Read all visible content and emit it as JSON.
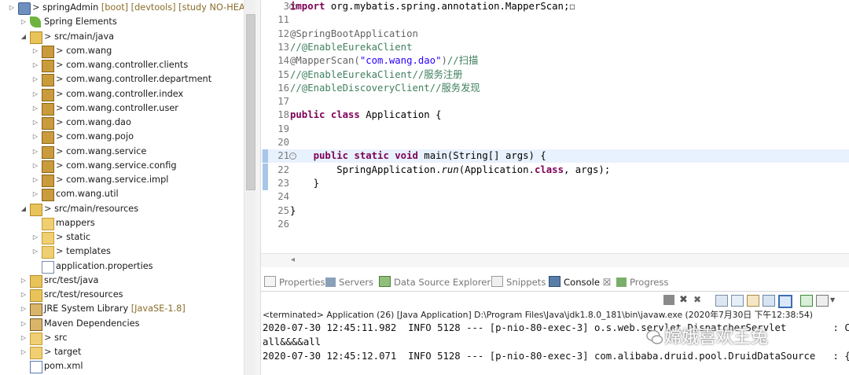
{
  "tree": {
    "rows": [
      {
        "tw": "▷",
        "label": "springAdmin",
        "deco": "[boot] [devtools] [study NO-HEAD]",
        "prefix": ">",
        "icon": "project-icon"
      },
      {
        "tw": "▷",
        "label": "Spring Elements",
        "icon": "spring-leaf-icon"
      },
      {
        "tw": "◢",
        "label": "src/main/java",
        "prefix": ">",
        "icon": "source-folder-icon"
      },
      {
        "tw": "▷",
        "label": "com.wang",
        "prefix": ">",
        "icon": "package-icon"
      },
      {
        "tw": "▷",
        "label": "com.wang.controller.clients",
        "prefix": ">",
        "icon": "package-icon"
      },
      {
        "tw": "▷",
        "label": "com.wang.controller.department",
        "prefix": ">",
        "icon": "package-icon"
      },
      {
        "tw": "▷",
        "label": "com.wang.controller.index",
        "prefix": ">",
        "icon": "package-icon"
      },
      {
        "tw": "▷",
        "label": "com.wang.controller.user",
        "prefix": ">",
        "icon": "package-icon"
      },
      {
        "tw": "▷",
        "label": "com.wang.dao",
        "prefix": ">",
        "icon": "package-icon"
      },
      {
        "tw": "▷",
        "label": "com.wang.pojo",
        "prefix": ">",
        "icon": "package-icon"
      },
      {
        "tw": "▷",
        "label": "com.wang.service",
        "prefix": ">",
        "icon": "package-icon"
      },
      {
        "tw": "▷",
        "label": "com.wang.service.config",
        "prefix": ">",
        "icon": "package-icon"
      },
      {
        "tw": "▷",
        "label": "com.wang.service.impl",
        "prefix": ">",
        "icon": "package-icon"
      },
      {
        "tw": "▷",
        "label": "com.wang.util",
        "icon": "package-icon"
      },
      {
        "tw": "◢",
        "label": "src/main/resources",
        "prefix": ">",
        "icon": "source-folder-icon"
      },
      {
        "tw": "",
        "label": "mappers",
        "icon": "folder-icon"
      },
      {
        "tw": "▷",
        "label": "static",
        "prefix": ">",
        "icon": "folder-icon"
      },
      {
        "tw": "▷",
        "label": "templates",
        "prefix": ">",
        "icon": "folder-icon"
      },
      {
        "tw": "",
        "label": "application.properties",
        "icon": "properties-file-icon"
      },
      {
        "tw": "▷",
        "label": "src/test/java",
        "icon": "source-folder-icon"
      },
      {
        "tw": "▷",
        "label": "src/test/resources",
        "icon": "source-folder-icon"
      },
      {
        "tw": "▷",
        "label": "JRE System Library",
        "deco": "[JavaSE-1.8]",
        "icon": "library-icon"
      },
      {
        "tw": "▷",
        "label": "Maven Dependencies",
        "icon": "library-icon"
      },
      {
        "tw": "▷",
        "label": "src",
        "prefix": ">",
        "icon": "folder-icon"
      },
      {
        "tw": "▷",
        "label": "target",
        "prefix": ">",
        "icon": "folder-icon"
      },
      {
        "tw": "",
        "label": "pom.xml",
        "icon": "xml-file-icon"
      }
    ]
  },
  "editor": {
    "lines": [
      {
        "n": "3",
        "segs": [
          {
            "c": "kw",
            "t": "import"
          },
          {
            "c": "",
            "t": " org.mybatis.spring.annotation.MapperScan;"
          },
          {
            "c": "",
            "t": "☐"
          }
        ],
        "fold": true
      },
      {
        "n": "11",
        "segs": []
      },
      {
        "n": "12",
        "segs": [
          {
            "c": "an",
            "t": "@SpringBootApplication"
          }
        ]
      },
      {
        "n": "13",
        "segs": [
          {
            "c": "cm",
            "t": "//@EnableEurekaClient"
          }
        ]
      },
      {
        "n": "14",
        "segs": [
          {
            "c": "an",
            "t": "@MapperScan("
          },
          {
            "c": "st",
            "t": "\"com.wang.dao\""
          },
          {
            "c": "an",
            "t": ")"
          },
          {
            "c": "cm",
            "t": "//扫描"
          }
        ]
      },
      {
        "n": "15",
        "segs": [
          {
            "c": "cm",
            "t": "//@EnableEurekaClient//服务注册"
          }
        ]
      },
      {
        "n": "16",
        "segs": [
          {
            "c": "cm",
            "t": "//@EnableDiscoveryClient//服务发现"
          }
        ]
      },
      {
        "n": "17",
        "segs": []
      },
      {
        "n": "18",
        "segs": [
          {
            "c": "kw",
            "t": "public class"
          },
          {
            "c": "",
            "t": " Application {"
          }
        ]
      },
      {
        "n": "19",
        "segs": []
      },
      {
        "n": "20",
        "segs": []
      },
      {
        "n": "21",
        "segs": [
          {
            "c": "",
            "t": "    "
          },
          {
            "c": "kw",
            "t": "public static void"
          },
          {
            "c": "",
            "t": " main(String[] args) {"
          }
        ],
        "fold": true,
        "current": true,
        "mark": true
      },
      {
        "n": "22",
        "segs": [
          {
            "c": "",
            "t": "        SpringApplication."
          },
          {
            "c": "it",
            "t": "run"
          },
          {
            "c": "",
            "t": "(Application."
          },
          {
            "c": "kw",
            "t": "class"
          },
          {
            "c": "",
            "t": ", args);"
          }
        ],
        "mark": true
      },
      {
        "n": "23",
        "segs": [
          {
            "c": "",
            "t": "    }"
          }
        ],
        "mark": true
      },
      {
        "n": "24",
        "segs": []
      },
      {
        "n": "25",
        "segs": [
          {
            "c": "",
            "t": "}"
          }
        ]
      },
      {
        "n": "26",
        "segs": []
      }
    ]
  },
  "views": {
    "tabs": [
      {
        "label": "Properties",
        "icon": "properties-view-icon"
      },
      {
        "label": "Servers",
        "icon": "servers-view-icon"
      },
      {
        "label": "Data Source Explorer",
        "icon": "data-source-icon"
      },
      {
        "label": "Snippets",
        "icon": "snippets-icon"
      },
      {
        "label": "Console",
        "icon": "console-icon",
        "active": true,
        "close": "☒"
      },
      {
        "label": "Progress",
        "icon": "progress-icon"
      }
    ],
    "console_header": "<terminated> Application (26) [Java Application] D:\\Program Files\\Java\\jdk1.8.0_181\\bin\\javaw.exe (2020年7月30日 下午12:38:54)",
    "console_lines": [
      "2020-07-30 12:45:11.982  INFO 5128 --- [p-nio-80-exec-3] o.s.web.servlet.DispatcherServlet        : Co",
      "all&&&&all",
      "2020-07-30 12:45:12.071  INFO 5128 --- [p-nio-80-exec-3] com.alibaba.druid.pool.DruidDataSource   : {d"
    ]
  },
  "watermark": "嫦娥喜欢王兔"
}
